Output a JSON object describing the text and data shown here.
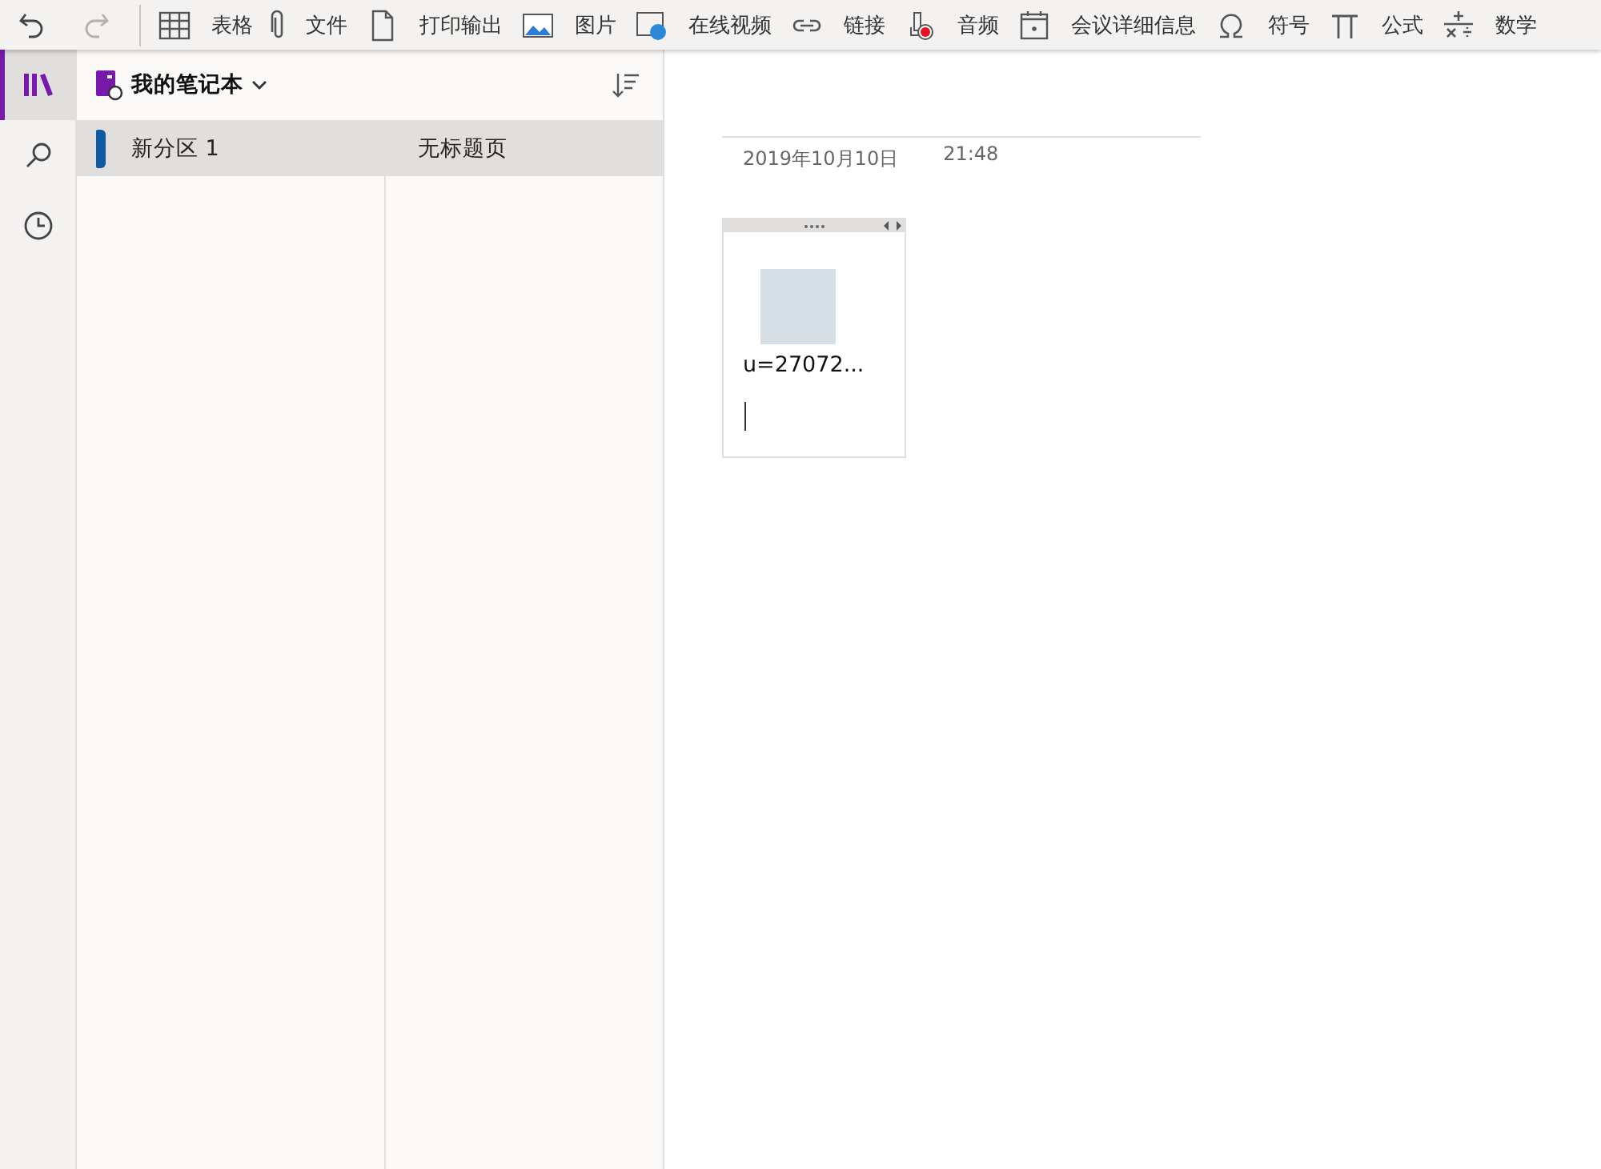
{
  "toolbar": {
    "history": [
      {
        "kind": "undo",
        "disabled": false
      },
      {
        "kind": "redo",
        "disabled": true
      }
    ],
    "items": [
      {
        "kind": "table",
        "label": "表格"
      },
      {
        "kind": "file",
        "label": "文件"
      },
      {
        "kind": "printout",
        "label": "打印输出"
      },
      {
        "kind": "picture",
        "label": "图片"
      },
      {
        "kind": "video",
        "label": "在线视频"
      },
      {
        "kind": "link",
        "label": "链接"
      },
      {
        "kind": "audio",
        "label": "音频"
      },
      {
        "kind": "meeting",
        "label": "会议详细信息"
      },
      {
        "kind": "symbol",
        "label": "符号"
      },
      {
        "kind": "equation",
        "label": "公式"
      },
      {
        "kind": "math",
        "label": "数学"
      }
    ]
  },
  "rail": [
    {
      "kind": "notebooks",
      "selected": true
    },
    {
      "kind": "search",
      "selected": false
    },
    {
      "kind": "recent",
      "selected": false
    }
  ],
  "notebook": {
    "title": "我的笔记本"
  },
  "sections": [
    {
      "label": "新分区 1",
      "selected": true,
      "color": "#0f5aa0"
    }
  ],
  "pages": [
    {
      "label": "无标题页",
      "selected": true
    }
  ],
  "page": {
    "date": "2019年10月10日",
    "time": "21:48",
    "container": {
      "image_caption": "u=27072..."
    }
  }
}
